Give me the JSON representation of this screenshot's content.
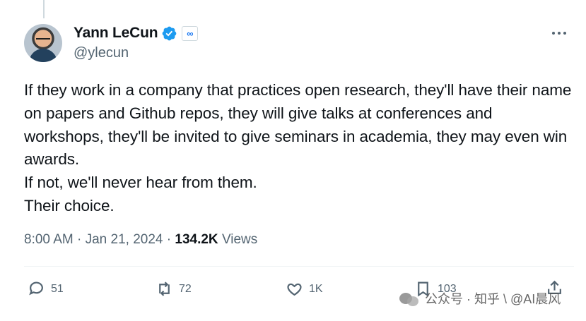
{
  "author": {
    "display_name": "Yann LeCun",
    "handle": "@ylecun",
    "affiliation_icon": "meta-infinity-icon",
    "verified_color": "#1d9bf0"
  },
  "tweet": {
    "text_lines": [
      "If they work in a company that practices open research, they'll have their name on papers and Github repos, they will give talks at conferences and workshops, they'll be invited to give seminars in academia, they may even win awards.",
      "If not, we'll never hear from them.",
      "Their choice."
    ],
    "time": "8:00 AM",
    "date": "Jan 21, 2024",
    "views_count": "134.2K",
    "views_label": "Views",
    "separator": "·"
  },
  "actions": {
    "replies": "51",
    "reposts": "72",
    "likes": "1K",
    "bookmarks": "103"
  },
  "watermark": {
    "text": "公众号 · 知乎 \\ @AI晨风"
  },
  "colors": {
    "text": "#0f1419",
    "secondary": "#536471",
    "divider": "#eff3f4",
    "accent": "#1d9bf0"
  }
}
